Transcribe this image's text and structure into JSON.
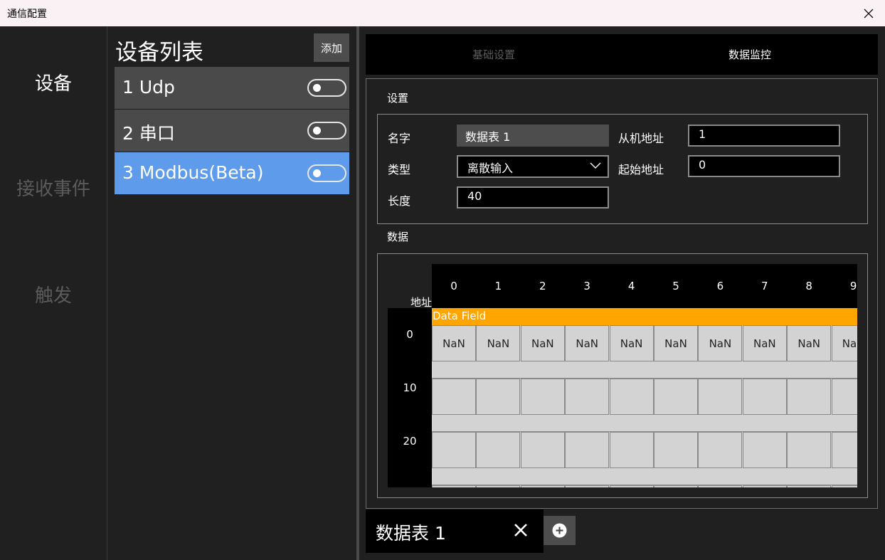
{
  "window": {
    "title": "通信配置",
    "close_icon": "close-icon"
  },
  "nav": {
    "items": [
      {
        "label": "设备",
        "active": true
      },
      {
        "label": "接收事件",
        "active": false
      },
      {
        "label": "触发",
        "active": false
      }
    ]
  },
  "devices": {
    "heading": "设备列表",
    "add_label": "添加",
    "items": [
      {
        "label": "1 Udp",
        "enabled": false,
        "selected": false
      },
      {
        "label": "2 串口",
        "enabled": false,
        "selected": false
      },
      {
        "label": "3 Modbus(Beta)",
        "enabled": false,
        "selected": true
      }
    ]
  },
  "tabs": [
    {
      "label": "基础设置",
      "active": false
    },
    {
      "label": "数据监控",
      "active": true
    }
  ],
  "settings": {
    "section_label": "设置",
    "name_label": "名字",
    "name_value": "数据表 1",
    "type_label": "类型",
    "type_value": "离散输入",
    "length_label": "长度",
    "length_value": "40",
    "slave_label": "从机地址",
    "slave_value": "1",
    "start_label": "起始地址",
    "start_value": "0"
  },
  "data": {
    "section_label": "数据",
    "address_header": "地址",
    "field_label": "Data Field",
    "columns": [
      "0",
      "1",
      "2",
      "3",
      "4",
      "5",
      "6",
      "7",
      "8",
      "9"
    ],
    "rows": [
      "0",
      "10",
      "20"
    ],
    "row0_values": [
      "NaN",
      "NaN",
      "NaN",
      "NaN",
      "NaN",
      "NaN",
      "NaN",
      "NaN",
      "NaN",
      "NaN"
    ]
  },
  "bottom": {
    "tab_label": "数据表 1"
  },
  "colors": {
    "accent": "#5e9ceb",
    "data_field": "#ffa500",
    "cell": "#d3d3d3"
  }
}
